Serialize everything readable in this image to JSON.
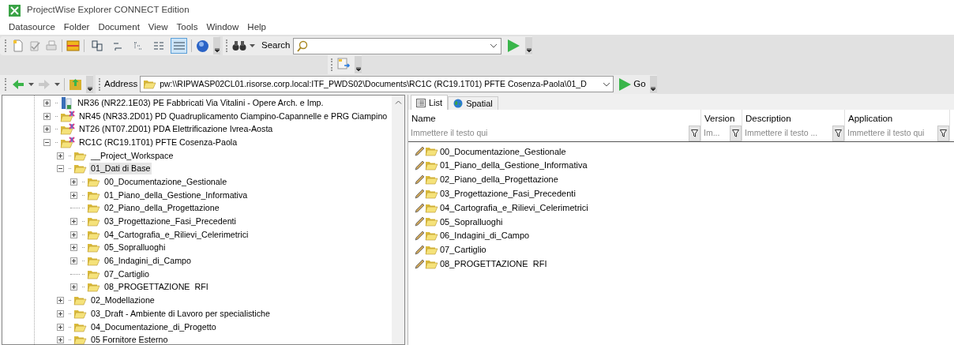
{
  "window": {
    "title": "ProjectWise Explorer CONNECT Edition"
  },
  "menu": [
    "Datasource",
    "Folder",
    "Document",
    "View",
    "Tools",
    "Window",
    "Help"
  ],
  "toolbar": {
    "view_modes": [
      {
        "selected": false
      },
      {
        "selected": false
      },
      {
        "selected": false
      },
      {
        "selected": false
      },
      {
        "selected": true
      }
    ],
    "search_label": "Search"
  },
  "address_bar": {
    "label": "Address",
    "value": "pw:\\\\RIPWASP02CL01.risorse.corp.local:ITF_PWDS02\\Documents\\RC1C (RC19.1T01) PFTE Cosenza-Paola\\01_D",
    "go": "Go"
  },
  "tree": [
    {
      "label": "NR36 (NR22.1E03) PE Fabbricati Via Vitalini - Opere Arch. e Imp.",
      "kind": "workarea",
      "expanded": false,
      "selected": false
    },
    {
      "label": "NR45 (NR33.2D01) PD Quadruplicamento Ciampino-Capannelle e PRG Ciampino",
      "kind": "project",
      "expanded": false,
      "selected": false
    },
    {
      "label": "NT26 (NT07.2D01) PDA Elettrificazione Ivrea-Aosta",
      "kind": "project",
      "expanded": false,
      "selected": false
    },
    {
      "label": "RC1C (RC19.1T01) PFTE Cosenza-Paola",
      "kind": "project",
      "expanded": true,
      "selected": false,
      "children": [
        {
          "label": "__Project_Workspace",
          "kind": "folder",
          "expanded": false,
          "selected": false
        },
        {
          "label": "01_Dati di Base",
          "kind": "folder",
          "expanded": true,
          "selected": true,
          "children": [
            {
              "label": "00_Documentazione_Gestionale",
              "kind": "folder",
              "expanded": false,
              "selected": false
            },
            {
              "label": "01_Piano_della_Gestione_Informativa",
              "kind": "folder",
              "expanded": false,
              "selected": false
            },
            {
              "label": "02_Piano_della_Progettazione",
              "kind": "folder",
              "selected": false
            },
            {
              "label": "03_Progettazione_Fasi_Precedenti",
              "kind": "folder",
              "expanded": false,
              "selected": false
            },
            {
              "label": "04_Cartografia_e_Rilievi_Celerimetrici",
              "kind": "folder",
              "expanded": false,
              "selected": false
            },
            {
              "label": "05_Sopralluoghi",
              "kind": "folder",
              "expanded": false,
              "selected": false
            },
            {
              "label": "06_Indagini_di_Campo",
              "kind": "folder",
              "expanded": false,
              "selected": false
            },
            {
              "label": "07_Cartiglio",
              "kind": "folder",
              "selected": false
            },
            {
              "label": "08_PROGETTAZIONE  RFI",
              "kind": "folder",
              "expanded": false,
              "selected": false
            }
          ]
        },
        {
          "label": "02_Modellazione",
          "kind": "folder",
          "expanded": false,
          "selected": false
        },
        {
          "label": "03_Draft - Ambiente di Lavoro per specialistiche",
          "kind": "folder",
          "expanded": false,
          "selected": false
        },
        {
          "label": "04_Documentazione_di_Progetto",
          "kind": "folder",
          "expanded": false,
          "selected": false
        },
        {
          "label": "05 Fornitore Esterno",
          "kind": "folder",
          "expanded": false,
          "selected": false
        }
      ]
    }
  ],
  "tabs": [
    {
      "label": "List",
      "kind": "list",
      "selected": true
    },
    {
      "label": "Spatial",
      "kind": "spatial",
      "selected": false
    }
  ],
  "table": {
    "columns": [
      {
        "label": "Name",
        "placeholder": "Immettere il testo qui"
      },
      {
        "label": "Version",
        "placeholder": "Im..."
      },
      {
        "label": "Description",
        "placeholder": "Immettere il testo ..."
      },
      {
        "label": "Application",
        "placeholder": "Immettere il testo qui"
      }
    ],
    "rows": [
      {
        "name": "00_Documentazione_Gestionale"
      },
      {
        "name": "01_Piano_della_Gestione_Informativa"
      },
      {
        "name": "02_Piano_della_Progettazione"
      },
      {
        "name": "03_Progettazione_Fasi_Precedenti"
      },
      {
        "name": "04_Cartografia_e_Rilievi_Celerimetrici"
      },
      {
        "name": "05_Sopralluoghi"
      },
      {
        "name": "06_Indagini_di_Campo"
      },
      {
        "name": "07_Cartiglio"
      },
      {
        "name": "08_PROGETTAZIONE  RFI"
      }
    ]
  }
}
